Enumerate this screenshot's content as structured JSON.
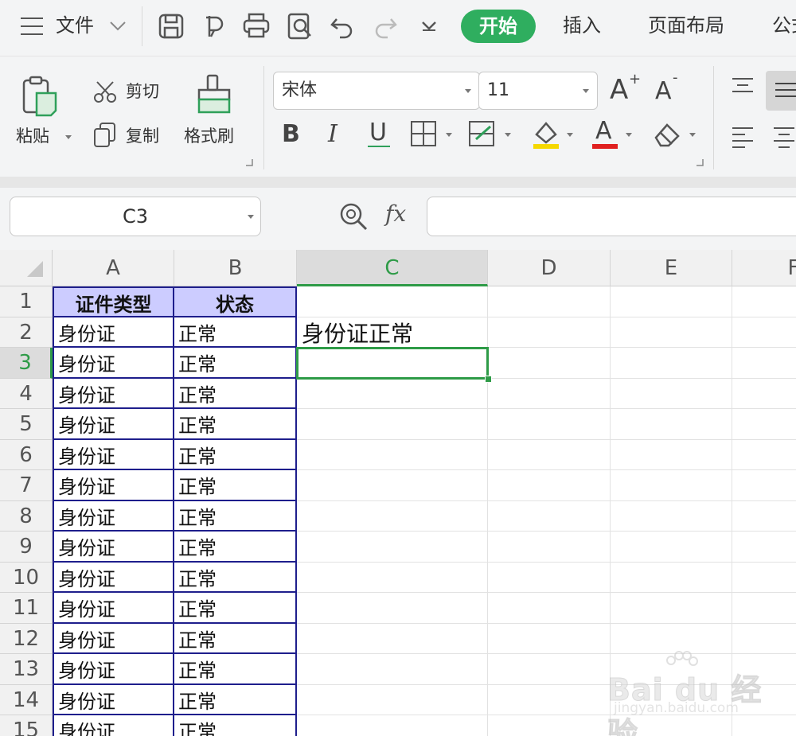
{
  "topbar": {
    "menu_label": "文件",
    "tabs": [
      "开始",
      "插入",
      "页面布局",
      "公式"
    ],
    "active_tab": "开始"
  },
  "ribbon": {
    "paste_label": "粘贴",
    "cut_label": "剪切",
    "copy_label": "复制",
    "format_painter_label": "格式刷",
    "font_name": "宋体",
    "font_size": "11",
    "bold": "B",
    "italic": "I",
    "underline": "U",
    "grow_font": "A",
    "shrink_font": "A",
    "font_color_letter": "A",
    "font_color": "#e02020",
    "fill_color": "#f5d800"
  },
  "formula_bar": {
    "name_box": "C3",
    "fx": "fx",
    "formula": ""
  },
  "sheet": {
    "columns": [
      "A",
      "B",
      "C",
      "D",
      "E",
      "F"
    ],
    "active_column": "C",
    "active_row": "3",
    "rows": [
      {
        "n": "1",
        "a": "证件类型",
        "b": "状态",
        "c": ""
      },
      {
        "n": "2",
        "a": "身份证",
        "b": "正常",
        "c": "身份证正常"
      },
      {
        "n": "3",
        "a": "身份证",
        "b": "正常",
        "c": ""
      },
      {
        "n": "4",
        "a": "身份证",
        "b": "正常",
        "c": ""
      },
      {
        "n": "5",
        "a": "身份证",
        "b": "正常",
        "c": ""
      },
      {
        "n": "6",
        "a": "身份证",
        "b": "正常",
        "c": ""
      },
      {
        "n": "7",
        "a": "身份证",
        "b": "正常",
        "c": ""
      },
      {
        "n": "8",
        "a": "身份证",
        "b": "正常",
        "c": ""
      },
      {
        "n": "9",
        "a": "身份证",
        "b": "正常",
        "c": ""
      },
      {
        "n": "10",
        "a": "身份证",
        "b": "正常",
        "c": ""
      },
      {
        "n": "11",
        "a": "身份证",
        "b": "正常",
        "c": ""
      },
      {
        "n": "12",
        "a": "身份证",
        "b": "正常",
        "c": ""
      },
      {
        "n": "13",
        "a": "身份证",
        "b": "正常",
        "c": ""
      },
      {
        "n": "14",
        "a": "身份证",
        "b": "正常",
        "c": ""
      },
      {
        "n": "15",
        "a": "身份证",
        "b": "正常",
        "c": ""
      }
    ]
  },
  "watermark": {
    "line1": "Bai du 经验",
    "line2": "jingyan.baidu.com"
  }
}
